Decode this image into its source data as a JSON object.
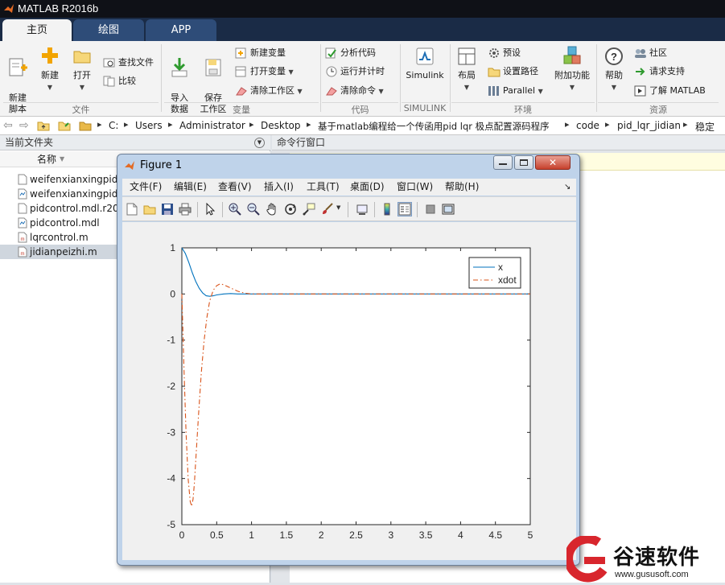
{
  "window": {
    "title": "MATLAB R2016b"
  },
  "tabs": [
    {
      "label": "主页"
    },
    {
      "label": "绘图"
    },
    {
      "label": "APP"
    }
  ],
  "ribbon": {
    "file_group": {
      "label": "文件",
      "new_script": "新建\n脚本",
      "new": "新建",
      "open": "打开",
      "find_files": "查找文件",
      "compare": "比较"
    },
    "variable_group": {
      "label": "变量",
      "import_data": "导入\n数据",
      "save_workspace": "保存\n工作区",
      "new_variable": "新建变量",
      "open_variable": "打开变量",
      "clear_workspace": "清除工作区"
    },
    "code_group": {
      "label": "代码",
      "analyze_code": "分析代码",
      "run_time": "运行并计时",
      "clear_commands": "清除命令"
    },
    "simulink_group": {
      "label": "SIMULINK",
      "simulink": "Simulink"
    },
    "env_group": {
      "label": "环境",
      "layout": "布局",
      "preferences": "预设",
      "set_path": "设置路径",
      "parallel": "Parallel",
      "addons": "附加功能"
    },
    "resources_group": {
      "label": "资源",
      "help": "帮助",
      "community": "社区",
      "request_support": "请求支持",
      "learn_matlab": "了解 MATLAB"
    }
  },
  "address": {
    "crumbs": [
      "C:",
      "Users",
      "Administrator",
      "Desktop",
      "基于matlab编程给一个传函用pid lqr 极点配置源码程序",
      "code",
      "pid_lqr_jidian",
      "稳定"
    ]
  },
  "current_folder": {
    "title": "当前文件夹",
    "column_name": "名称",
    "files": [
      {
        "name": "weifenxianxingpid",
        "selected": false
      },
      {
        "name": "weifenxianxingpid",
        "selected": false
      },
      {
        "name": "pidcontrol.mdl.r20",
        "selected": false
      },
      {
        "name": "pidcontrol.mdl",
        "selected": false
      },
      {
        "name": "lqrcontrol.m",
        "selected": false
      },
      {
        "name": "jidianpeizhi.m",
        "selected": true
      }
    ]
  },
  "command_window": {
    "title": "命令行窗口"
  },
  "figure": {
    "title": "Figure 1",
    "menu": [
      "文件(F)",
      "编辑(E)",
      "查看(V)",
      "插入(I)",
      "工具(T)",
      "桌面(D)",
      "窗口(W)",
      "帮助(H)"
    ]
  },
  "chart_data": {
    "type": "line",
    "title": "",
    "xlabel": "",
    "ylabel": "",
    "xlim": [
      0,
      5
    ],
    "ylim": [
      -5,
      1
    ],
    "xticks": [
      0,
      0.5,
      1,
      1.5,
      2,
      2.5,
      3,
      3.5,
      4,
      4.5,
      5
    ],
    "yticks": [
      1,
      0,
      -1,
      -2,
      -3,
      -4,
      -5
    ],
    "legend_position": "top-right",
    "series": [
      {
        "name": "x",
        "color": "#0072bd",
        "style": "solid",
        "x": [
          0,
          0.05,
          0.1,
          0.15,
          0.2,
          0.25,
          0.3,
          0.35,
          0.4,
          0.45,
          0.5,
          0.6,
          0.7,
          0.8,
          0.9,
          1.0,
          1.2,
          1.5,
          2,
          3,
          4,
          5
        ],
        "y": [
          1,
          0.88,
          0.68,
          0.46,
          0.27,
          0.12,
          0.02,
          -0.04,
          -0.05,
          -0.04,
          -0.02,
          0.0,
          0.01,
          0.0,
          0.0,
          0.0,
          0.0,
          0.0,
          0.0,
          0.0,
          0.0,
          0.0
        ]
      },
      {
        "name": "xdot",
        "color": "#d95319",
        "style": "dashdot",
        "x": [
          0,
          0.03,
          0.06,
          0.09,
          0.12,
          0.14,
          0.16,
          0.18,
          0.2,
          0.24,
          0.28,
          0.32,
          0.36,
          0.4,
          0.45,
          0.5,
          0.55,
          0.6,
          0.7,
          0.8,
          0.9,
          1.0,
          1.2,
          1.5,
          2,
          3,
          4,
          5
        ],
        "y": [
          0,
          -1.6,
          -3.0,
          -4.0,
          -4.5,
          -4.6,
          -4.45,
          -4.1,
          -3.6,
          -2.6,
          -1.7,
          -1.0,
          -0.5,
          -0.15,
          0.08,
          0.18,
          0.22,
          0.2,
          0.13,
          0.06,
          0.02,
          0.0,
          0.0,
          0.0,
          0.0,
          0.0,
          0.0,
          0.0
        ]
      }
    ]
  },
  "watermark": {
    "brand": "谷速软件",
    "url": "www.gususoft.com"
  }
}
